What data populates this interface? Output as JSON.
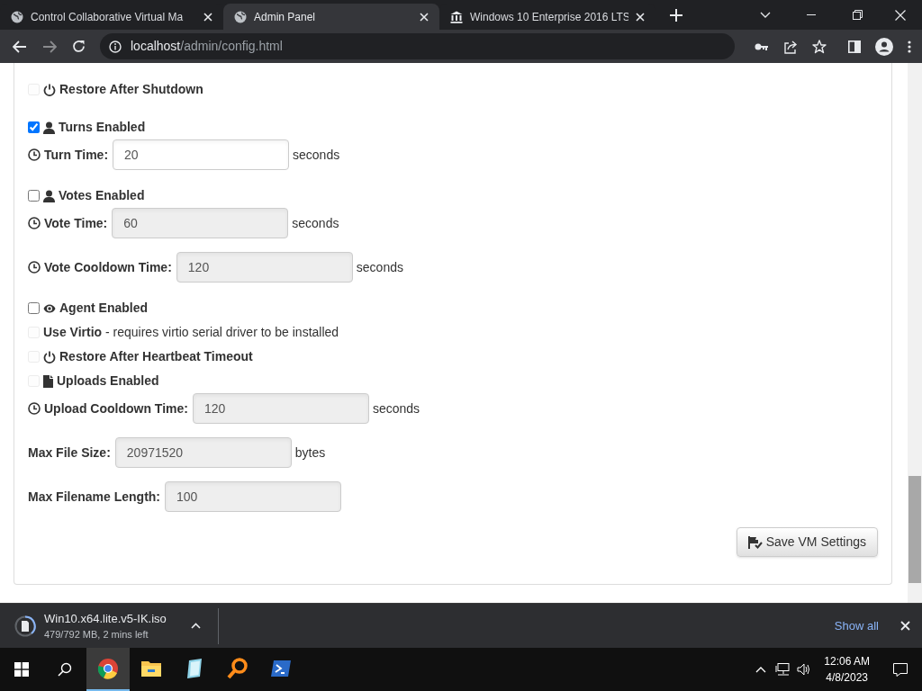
{
  "browser": {
    "tabs": [
      {
        "title": "Control Collaborative Virtual Ma",
        "selected": false
      },
      {
        "title": "Admin Panel",
        "selected": true
      },
      {
        "title": "Windows 10 Enterprise 2016 LTS",
        "selected": false
      }
    ],
    "address": {
      "host": "localhost",
      "path": "/admin/config.html"
    }
  },
  "settings": {
    "sections": [
      {
        "items": [
          {
            "kind": "checkbox",
            "label": "Restore After Shutdown",
            "checked": false,
            "disabled": true
          }
        ]
      },
      {
        "items": [
          {
            "kind": "checkbox",
            "label": "Turns Enabled",
            "checked": true,
            "disabled": false
          },
          {
            "kind": "field",
            "label": "Turn Time:",
            "value": "20",
            "unit": "seconds",
            "disabled": false
          }
        ]
      },
      {
        "items": [
          {
            "kind": "checkbox",
            "label": "Votes Enabled",
            "checked": false,
            "disabled": false
          },
          {
            "kind": "field",
            "label": "Vote Time:",
            "value": "60",
            "unit": "seconds",
            "disabled": true
          }
        ]
      },
      {
        "items": [
          {
            "kind": "field",
            "label": "Vote Cooldown Time:",
            "value": "120",
            "unit": "seconds",
            "disabled": true
          }
        ]
      },
      {
        "items": [
          {
            "kind": "checkbox",
            "label": "Agent Enabled",
            "checked": false,
            "disabled": false
          },
          {
            "kind": "checkbox",
            "label": "Use Virtio",
            "note": " - requires virtio serial driver to be installed",
            "checked": false,
            "disabled": true
          },
          {
            "kind": "checkbox",
            "label": "Restore After Heartbeat Timeout",
            "checked": false,
            "disabled": true
          },
          {
            "kind": "checkbox",
            "label": "Uploads Enabled",
            "checked": false,
            "disabled": true
          },
          {
            "kind": "field",
            "label": "Upload Cooldown Time:",
            "value": "120",
            "unit": "seconds",
            "disabled": true
          }
        ]
      },
      {
        "items": [
          {
            "kind": "field",
            "label": "Max File Size:",
            "value": "20971520",
            "unit": "bytes",
            "disabled": true
          }
        ]
      },
      {
        "items": [
          {
            "kind": "field",
            "label": "Max Filename Length:",
            "value": "100",
            "disabled": true
          }
        ]
      }
    ],
    "save_button": "Save VM Settings"
  },
  "download_bar": {
    "file": "Win10.x64.lite.v5-IK.iso",
    "status": "479/792 MB, 2 mins left",
    "show_all": "Show all"
  },
  "taskbar": {
    "apps": [
      {
        "kind": "browser",
        "selected": true
      },
      {
        "kind": "folder",
        "selected": false
      },
      {
        "kind": "notepad",
        "selected": false
      },
      {
        "kind": "magnifier",
        "selected": false
      },
      {
        "kind": "terminal",
        "selected": false
      }
    ],
    "time": "12:06 AM",
    "date": "4/8/2023"
  }
}
